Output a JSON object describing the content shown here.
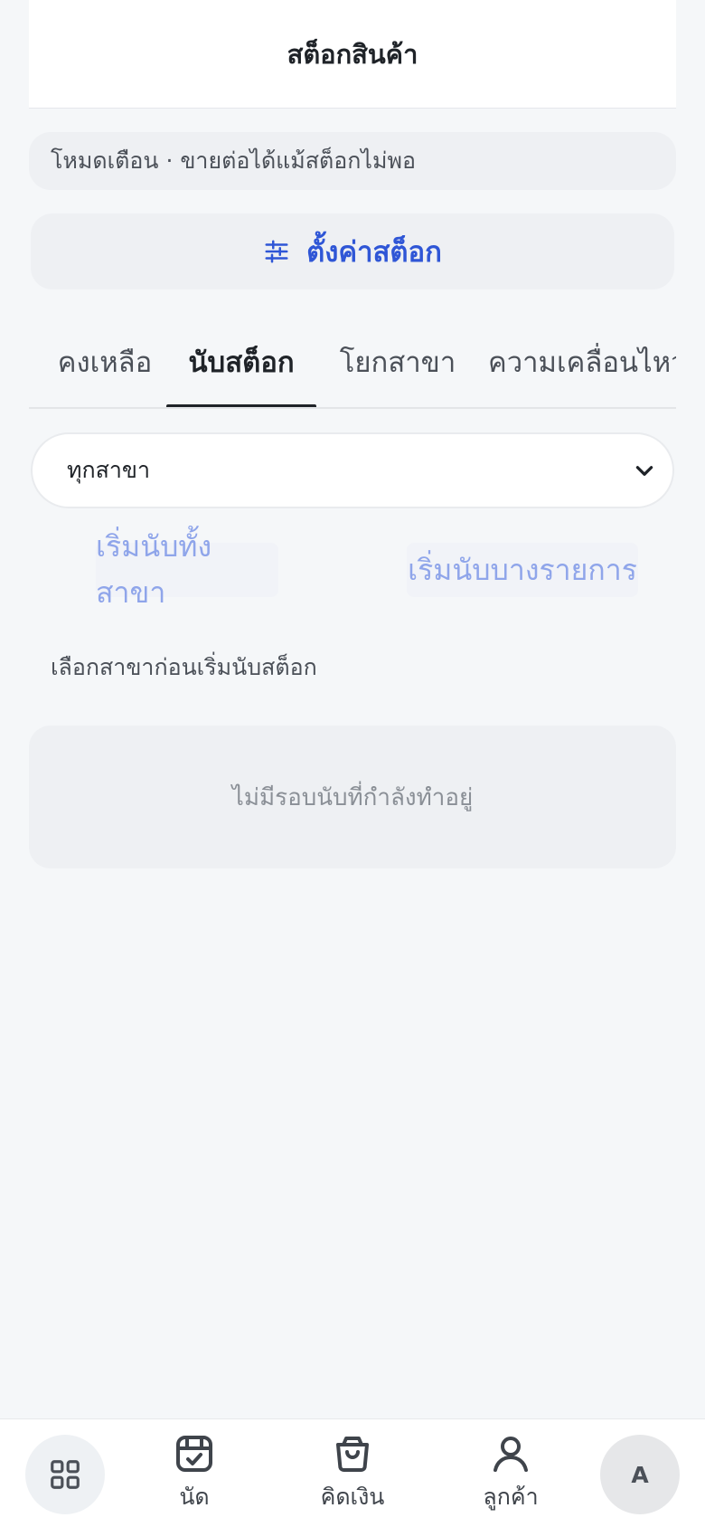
{
  "header": {
    "title": "สต็อกสินค้า"
  },
  "mode_banner": {
    "text": "โหมดเตือน · ขายต่อได้แม้สต็อกไม่พอ"
  },
  "settings_button": {
    "label": "ตั้งค่าสต็อก",
    "icon": "sliders-icon"
  },
  "tabs": [
    {
      "label": "คงเหลือ",
      "active": false
    },
    {
      "label": "นับสต็อก",
      "active": true
    },
    {
      "label": "โยกสาขา",
      "active": false
    },
    {
      "label": "ความเคลื่อนไหว",
      "active": false
    }
  ],
  "branch_select": {
    "selected": "ทุกสาขา"
  },
  "actions": {
    "count_all_label": "เริ่มนับทั้งสาขา",
    "count_some_label": "เริ่มนับบางรายการ"
  },
  "hint": "เลือกสาขาก่อนเริ่มนับสต็อก",
  "empty_state": "ไม่มีรอบนับที่กำลังทำอยู่",
  "bottom_nav": {
    "apps_icon": "grid-icon",
    "items": [
      {
        "label": "นัด",
        "icon": "calendar-check-icon"
      },
      {
        "label": "คิดเงิน",
        "icon": "shopping-bag-icon"
      },
      {
        "label": "ลูกค้า",
        "icon": "user-icon"
      }
    ],
    "avatar_initial": "A"
  },
  "colors": {
    "accent": "#2f56d6",
    "accent_light": "#8fa5ea",
    "background": "#f5f7f9",
    "panel": "#eef0f3"
  }
}
